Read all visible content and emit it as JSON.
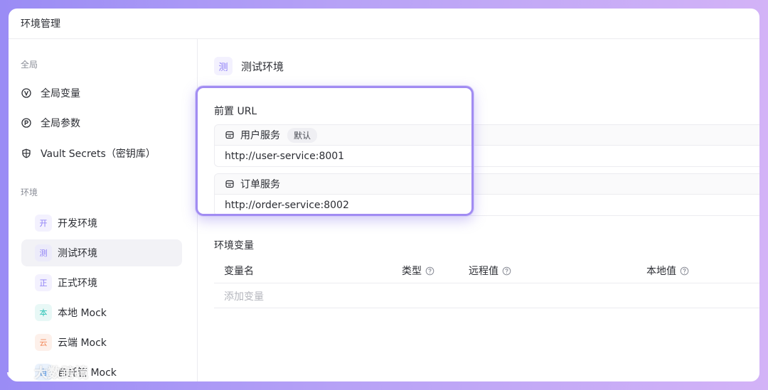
{
  "window": {
    "title": "环境管理"
  },
  "sidebar": {
    "global_title": "全局",
    "global_items": [
      {
        "icon": "v-circle-icon",
        "label": "全局变量"
      },
      {
        "icon": "p-circle-icon",
        "label": "全局参数"
      },
      {
        "icon": "shield-icon",
        "label": "Vault Secrets（密钥库）"
      }
    ],
    "env_title": "环境",
    "envs": [
      {
        "badge": "开",
        "label": "开发环境",
        "color": "#8b7cf6",
        "bg": "#f3f1fe",
        "active": false
      },
      {
        "badge": "测",
        "label": "测试环境",
        "color": "#8b7cf6",
        "bg": "#ecebfa",
        "active": true
      },
      {
        "badge": "正",
        "label": "正式环境",
        "color": "#8b7cf6",
        "bg": "#f3f1fe",
        "active": false
      },
      {
        "badge": "本",
        "label": "本地 Mock",
        "color": "#2ec4b6",
        "bg": "#e8f8f6",
        "active": false
      },
      {
        "badge": "云",
        "label": "云端 Mock",
        "color": "#f2895a",
        "bg": "#fdf0ea",
        "active": false
      },
      {
        "badge": "自",
        "label": "自托管 Mock",
        "color": "#4a90e2",
        "bg": "#eaf2fc",
        "active": false
      }
    ]
  },
  "main": {
    "env_badge": "测",
    "env_name": "测试环境",
    "url_section_title": "前置 URL",
    "services": [
      {
        "name": "用户服务",
        "tag": "默认",
        "url": "http://user-service:8001"
      },
      {
        "name": "订单服务",
        "tag": "",
        "url": "http://order-service:8002"
      }
    ],
    "vars_title": "环境变量",
    "table_headers": [
      "变量名",
      "类型",
      "远程值",
      "本地值"
    ],
    "add_placeholder": "添加变量"
  },
  "watermark": "大数跨境",
  "colors": {
    "accent": "#a18cf2",
    "active_bg": "#f2f2f6"
  }
}
